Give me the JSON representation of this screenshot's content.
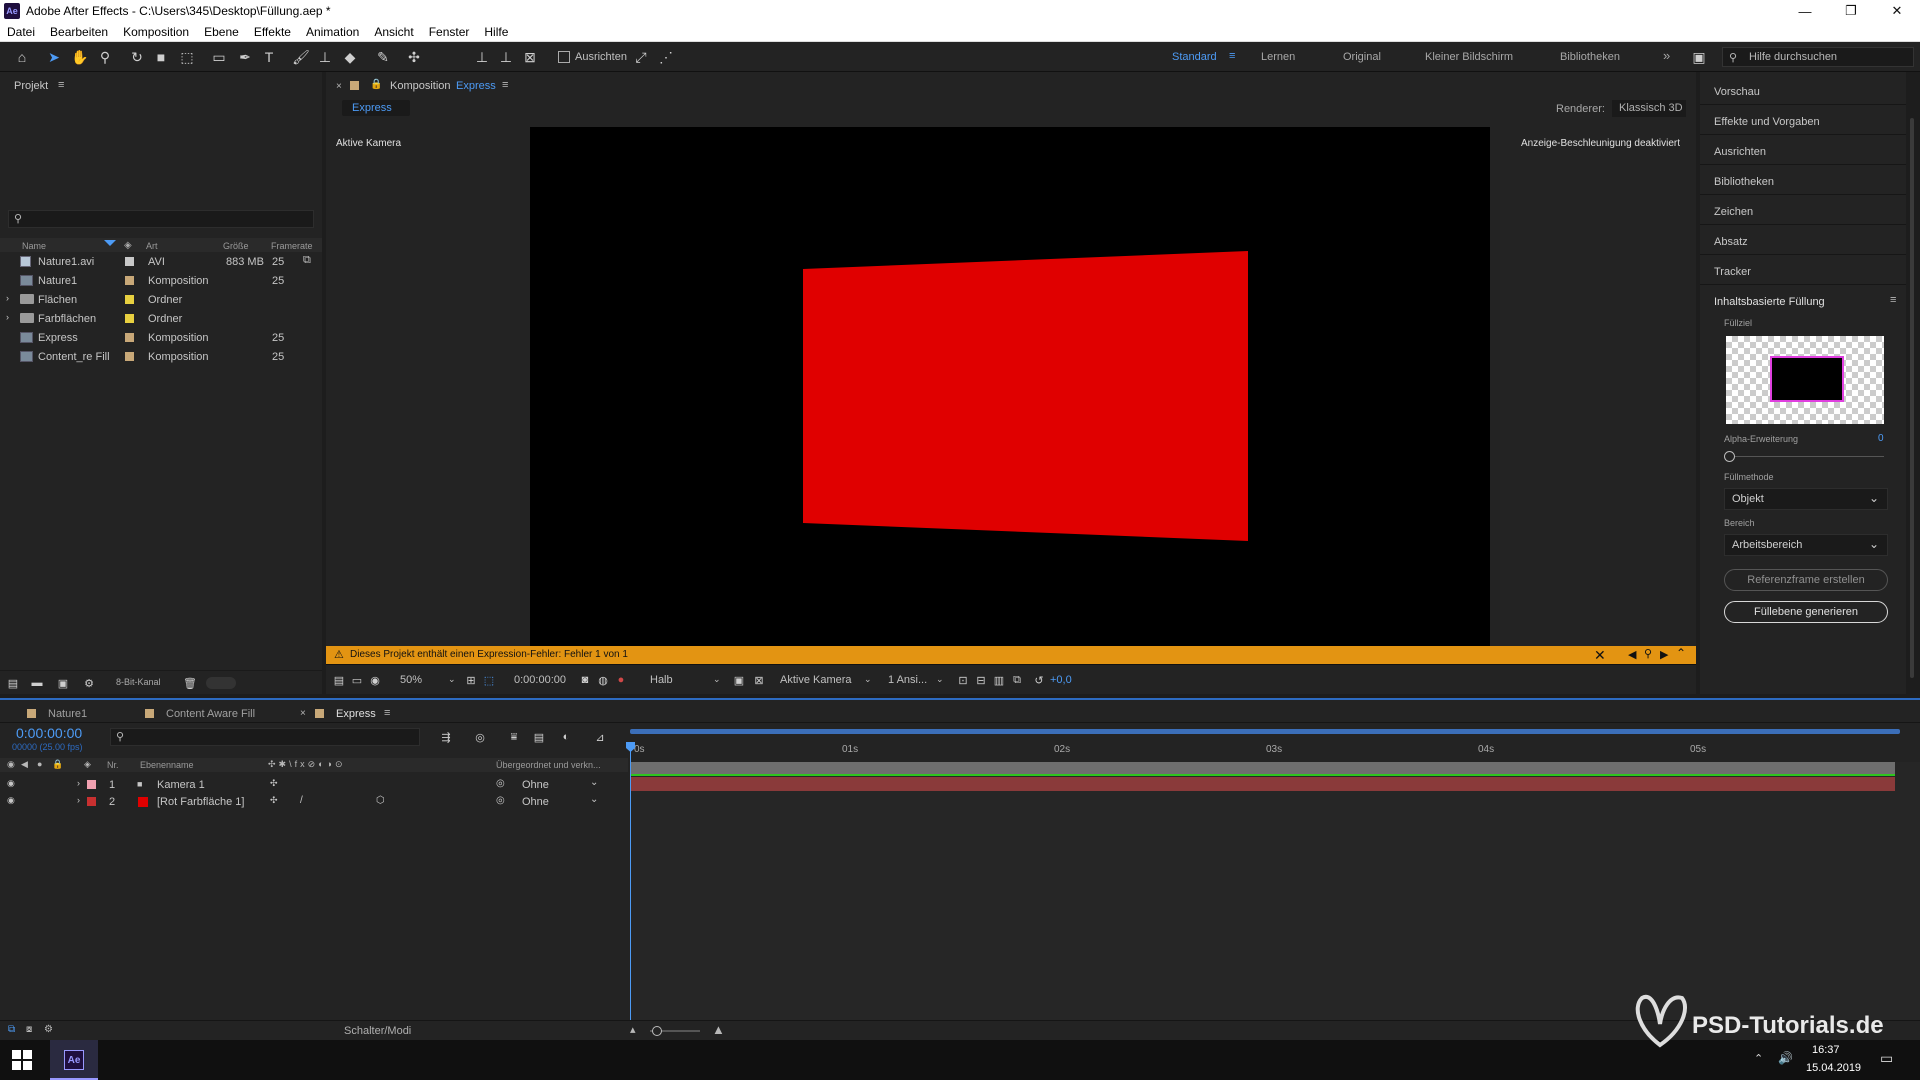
{
  "window": {
    "app_icon": "Ae",
    "title": "Adobe After Effects - C:\\Users\\345\\Desktop\\Füllung.aep *",
    "controls": [
      "—",
      "❐",
      "✕"
    ]
  },
  "menu": [
    "Datei",
    "Bearbeiten",
    "Komposition",
    "Ebene",
    "Effekte",
    "Animation",
    "Ansicht",
    "Fenster",
    "Hilfe"
  ],
  "toolbar": {
    "align_label": "Ausrichten",
    "workspaces": [
      "Standard",
      "Lernen",
      "Original",
      "Kleiner Bildschirm",
      "Bibliotheken"
    ],
    "active_workspace": "Standard",
    "more": "»",
    "help_placeholder": "Hilfe durchsuchen"
  },
  "project": {
    "title": "Projekt",
    "columns": {
      "name": "Name",
      "type": "Art",
      "size": "Größe",
      "framerate": "Framerate"
    },
    "items": [
      {
        "name": "Nature1.avi",
        "type": "AVI",
        "size": "883 MB",
        "fps": "25",
        "kind": "file",
        "color": "#c8c8c8"
      },
      {
        "name": "Nature1",
        "type": "Komposition",
        "size": "",
        "fps": "25",
        "kind": "comp",
        "color": "#c8a878"
      },
      {
        "name": "Flächen",
        "type": "Ordner",
        "size": "",
        "fps": "",
        "kind": "folder",
        "color": "#e8d040"
      },
      {
        "name": "Farbflächen",
        "type": "Ordner",
        "size": "",
        "fps": "",
        "kind": "folder",
        "color": "#e8d040"
      },
      {
        "name": "Express",
        "type": "Komposition",
        "size": "",
        "fps": "25",
        "kind": "comp",
        "color": "#c8a878"
      },
      {
        "name": "Content_re Fill",
        "type": "Komposition",
        "size": "",
        "fps": "25",
        "kind": "comp",
        "color": "#c8a878"
      }
    ],
    "bit_depth": "8-Bit-Kanal"
  },
  "composition": {
    "panel_title": "Komposition",
    "comp_name": "Express",
    "tab": "Express",
    "renderer_label": "Renderer:",
    "renderer_value": "Klassisch 3D",
    "camera_label": "Aktive Kamera",
    "accel_notice": "Anzeige-Beschleunigung deaktiviert",
    "error_text": "Dieses Projekt enthält einen Expression-Fehler: Fehler 1 von 1",
    "zoom": "50%",
    "timecode": "0:00:00:00",
    "resolution": "Halb",
    "view_camera": "Aktive Kamera",
    "views": "1 Ansi...",
    "exposure": "+0,0",
    "layer_color": "#e00000"
  },
  "right_panel": {
    "items": [
      "Vorschau",
      "Effekte und Vorgaben",
      "Ausrichten",
      "Bibliotheken",
      "Zeichen",
      "Absatz",
      "Tracker"
    ],
    "caf_title": "Inhaltsbasierte Füllung",
    "fill_target_label": "Füllziel",
    "alpha_label": "Alpha-Erweiterung",
    "alpha_value": "0",
    "method_label": "Füllmethode",
    "method_value": "Objekt",
    "range_label": "Bereich",
    "range_value": "Arbeitsbereich",
    "ref_button": "Referenzframe erstellen",
    "gen_button": "Füllebene generieren"
  },
  "timeline": {
    "tabs": [
      {
        "label": "Nature1",
        "color": "#c8a878"
      },
      {
        "label": "Content Aware Fill",
        "color": "#c8a878"
      },
      {
        "label": "Express",
        "color": "#c8a878"
      }
    ],
    "timecode": "0:00:00:00",
    "frame_info": "00000 (25.00 fps)",
    "col_nr": "Nr.",
    "col_name": "Ebenenname",
    "col_parent": "Übergeordnet und verkn...",
    "layers": [
      {
        "nr": "1",
        "name": "Kamera 1",
        "parent": "Ohne",
        "color": "#f0a0b0"
      },
      {
        "nr": "2",
        "name": "[Rot Farbfläche 1]",
        "parent": "Ohne",
        "color": "#c83030"
      }
    ],
    "ticks": [
      "0s",
      "01s",
      "02s",
      "03s",
      "04s",
      "05s"
    ],
    "switches_label": "Schalter/Modi"
  },
  "taskbar": {
    "time": "16:37",
    "date": "15.04.2019",
    "app": "Ae"
  },
  "watermark": "PSD-Tutorials.de"
}
